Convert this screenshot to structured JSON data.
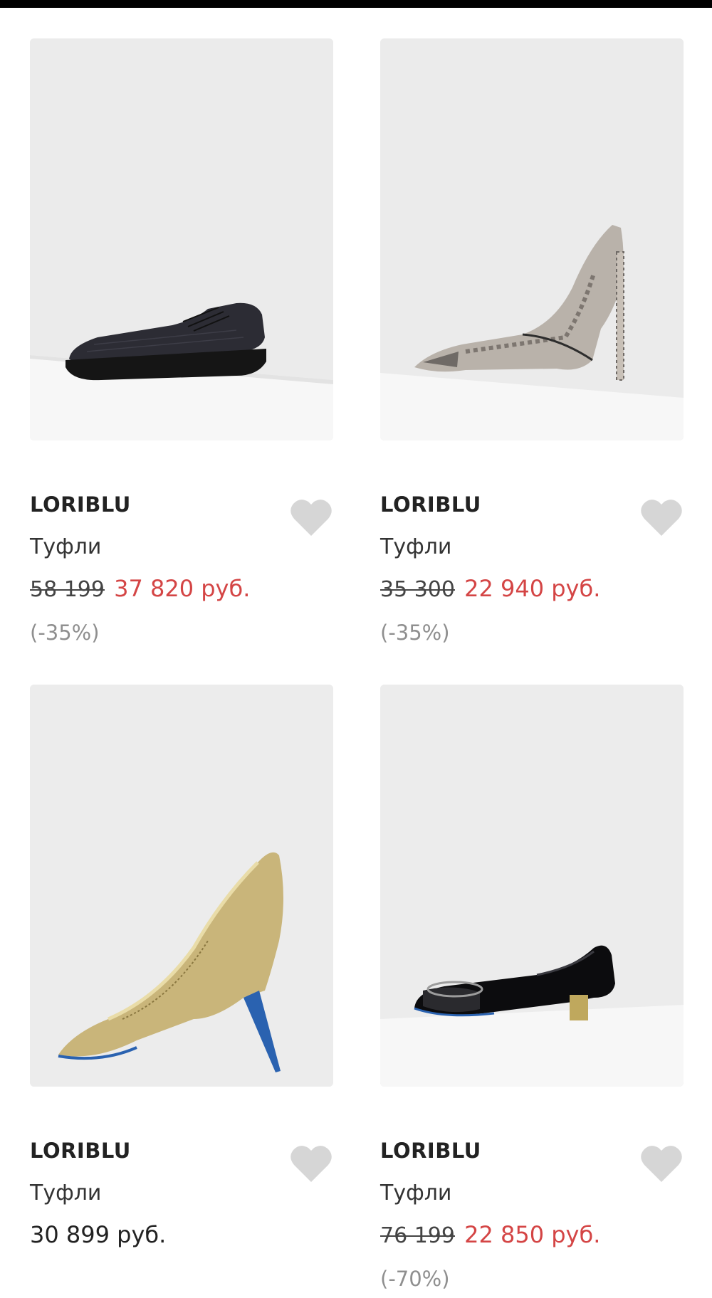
{
  "products": [
    {
      "brand": "LORIBLU",
      "category": "Туфли",
      "old_price": "58 199",
      "price": "37 820 руб.",
      "discount": "(-35%)",
      "image_icon": "oxford-shoe-image",
      "favorite_icon": "heart-icon"
    },
    {
      "brand": "LORIBLU",
      "category": "Туфли",
      "old_price": "35 300",
      "price": "22 940 руб.",
      "discount": "(-35%)",
      "image_icon": "snakeskin-pump-image",
      "favorite_icon": "heart-icon"
    },
    {
      "brand": "LORIBLU",
      "category": "Туфли",
      "regular_price": "30 899 руб.",
      "image_icon": "gold-pump-image",
      "favorite_icon": "heart-icon"
    },
    {
      "brand": "LORIBLU",
      "category": "Туфли",
      "old_price": "76 199",
      "price": "22 850 руб.",
      "discount": "(-70%)",
      "image_icon": "patent-flat-image",
      "favorite_icon": "heart-icon"
    }
  ],
  "colors": {
    "sale_price": "#d44545",
    "discount": "#8f8f8f",
    "heart": "#d6d6d6",
    "photo_background": "#ebebeb"
  }
}
